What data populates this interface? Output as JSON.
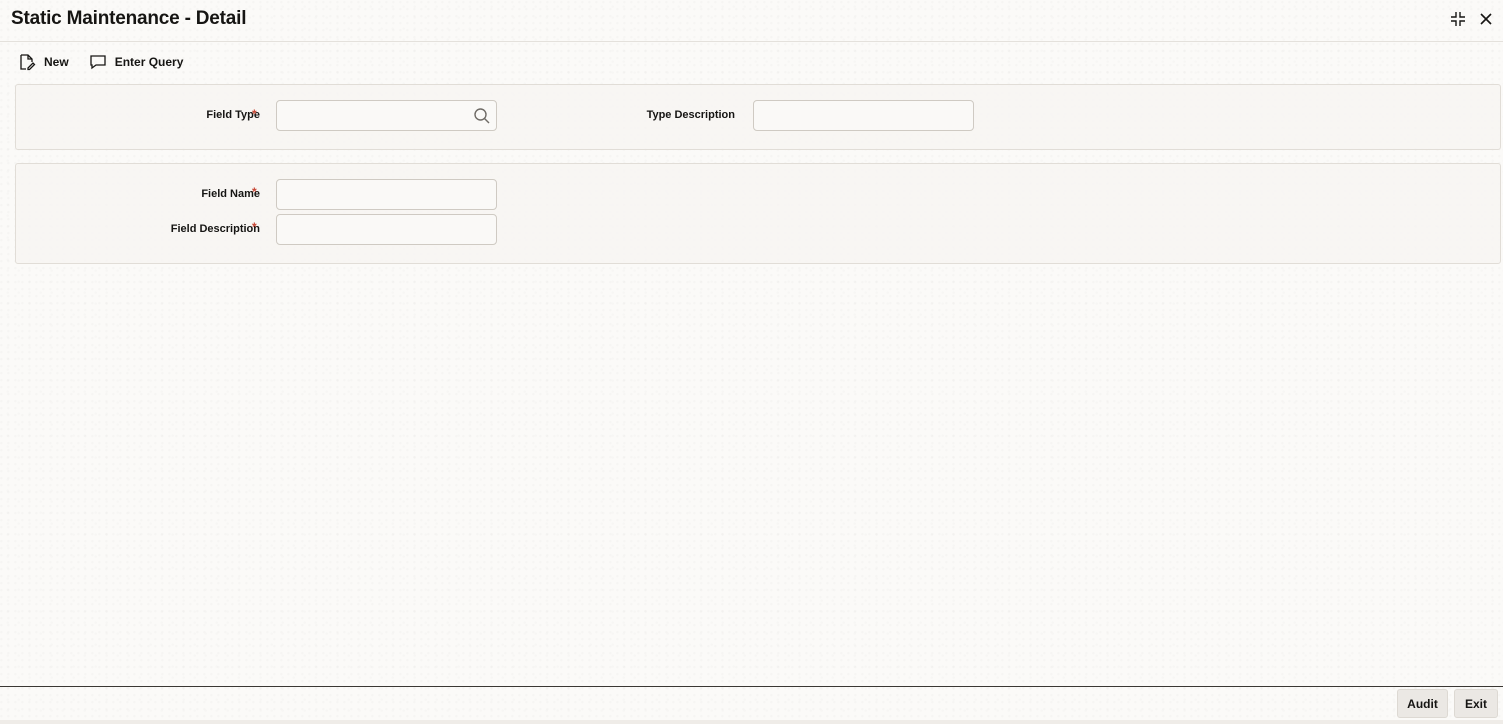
{
  "window": {
    "title": "Static Maintenance - Detail",
    "controls": {
      "minimize_icon": "collapse-icon",
      "close_icon": "close-icon"
    }
  },
  "toolbar": {
    "new_label": "New",
    "enter_query_label": "Enter Query"
  },
  "header_section": {
    "field_type": {
      "label": "Field Type",
      "required": "*",
      "value": ""
    },
    "type_description": {
      "label": "Type Description",
      "value": ""
    }
  },
  "detail_section": {
    "field_name": {
      "label": "Field Name",
      "required": "*",
      "value": ""
    },
    "field_description": {
      "label": "Field Description",
      "required": "*",
      "value": ""
    }
  },
  "footer": {
    "audit_label": "Audit",
    "exit_label": "Exit"
  },
  "colors": {
    "required": "#c74634",
    "text": "#161513",
    "background": "#fbfaf8"
  }
}
